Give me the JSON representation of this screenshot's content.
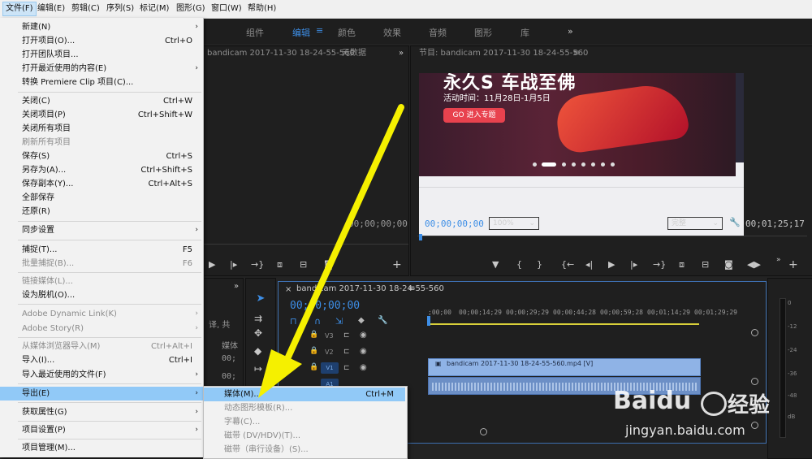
{
  "menubar": {
    "items": [
      "文件(F)",
      "编辑(E)",
      "剪辑(C)",
      "序列(S)",
      "标记(M)",
      "图形(G)",
      "窗口(W)",
      "帮助(H)"
    ]
  },
  "workspace_tabs": [
    "组件",
    "编辑",
    "颜色",
    "效果",
    "音频",
    "图形",
    "库"
  ],
  "workspace_more": "»",
  "source_panel": {
    "title": "bandicam 2017-11-30 18-24-55-560",
    "tab2": "元数据",
    "timecode": "00;00;00;00"
  },
  "program_panel": {
    "title": "节目: bandicam 2017-11-30 18-24-55-560",
    "timecode_left": "00;00;00;00",
    "zoom": "100%",
    "quality": "完整",
    "timecode_right": "00;01;25;17",
    "banner": {
      "headline": "永久S 车战至佛",
      "date_text": "活动时间：11月28日-1月5日",
      "button_text": "GO 进入专题"
    }
  },
  "project_panel": {
    "breadcrumb": "译, 共",
    "col_label": "媒体",
    "values": [
      "00;",
      "00;"
    ]
  },
  "timeline": {
    "tab_title": "bandicam 2017-11-30 18-24-55-560",
    "timecode": "00;00;00;00",
    "ruler": [
      ";00;00",
      "00;00;14;29",
      "00;00;29;29",
      "00;00;44;28",
      "00;00;59;28",
      "00;01;14;29",
      "00;01;29;29"
    ],
    "tracks": [
      "V3",
      "V2",
      "V1",
      "A1"
    ],
    "clip_label": "bandicam 2017-11-30 18-24-55-560.mp4 [V]"
  },
  "meter_labels": [
    "0",
    "-12",
    "-24",
    "-36",
    "-48",
    "dB"
  ],
  "file_menu": {
    "items": [
      {
        "label": "新建(N)",
        "shortcut": "",
        "submenu": true,
        "disabled": false
      },
      {
        "label": "打开项目(O)...",
        "shortcut": "Ctrl+O",
        "submenu": false,
        "disabled": false
      },
      {
        "label": "打开团队项目...",
        "shortcut": "",
        "submenu": false,
        "disabled": false
      },
      {
        "label": "打开最近使用的内容(E)",
        "shortcut": "",
        "submenu": true,
        "disabled": false
      },
      {
        "label": "转换 Premiere Clip 项目(C)...",
        "shortcut": "",
        "submenu": false,
        "disabled": false
      },
      {
        "label": "关闭(C)",
        "shortcut": "Ctrl+W",
        "submenu": false,
        "disabled": false
      },
      {
        "label": "关闭项目(P)",
        "shortcut": "Ctrl+Shift+W",
        "submenu": false,
        "disabled": false
      },
      {
        "label": "关闭所有项目",
        "shortcut": "",
        "submenu": false,
        "disabled": false
      },
      {
        "label": "刷新所有项目",
        "shortcut": "",
        "submenu": false,
        "disabled": true
      },
      {
        "label": "保存(S)",
        "shortcut": "Ctrl+S",
        "submenu": false,
        "disabled": false
      },
      {
        "label": "另存为(A)...",
        "shortcut": "Ctrl+Shift+S",
        "submenu": false,
        "disabled": false
      },
      {
        "label": "保存副本(Y)...",
        "shortcut": "Ctrl+Alt+S",
        "submenu": false,
        "disabled": false
      },
      {
        "label": "全部保存",
        "shortcut": "",
        "submenu": false,
        "disabled": false
      },
      {
        "label": "还原(R)",
        "shortcut": "",
        "submenu": false,
        "disabled": false
      },
      {
        "label": "同步设置",
        "shortcut": "",
        "submenu": true,
        "disabled": false
      },
      {
        "label": "捕捉(T)...",
        "shortcut": "F5",
        "submenu": false,
        "disabled": false
      },
      {
        "label": "批量捕捉(B)...",
        "shortcut": "F6",
        "submenu": false,
        "disabled": true
      },
      {
        "label": "链接媒体(L)...",
        "shortcut": "",
        "submenu": false,
        "disabled": true
      },
      {
        "label": "设为脱机(O)...",
        "shortcut": "",
        "submenu": false,
        "disabled": false
      },
      {
        "label": "Adobe Dynamic Link(K)",
        "shortcut": "",
        "submenu": true,
        "disabled": true
      },
      {
        "label": "Adobe Story(R)",
        "shortcut": "",
        "submenu": true,
        "disabled": true
      },
      {
        "label": "从媒体浏览器导入(M)",
        "shortcut": "Ctrl+Alt+I",
        "submenu": false,
        "disabled": true
      },
      {
        "label": "导入(I)...",
        "shortcut": "Ctrl+I",
        "submenu": false,
        "disabled": false
      },
      {
        "label": "导入最近使用的文件(F)",
        "shortcut": "",
        "submenu": true,
        "disabled": false
      },
      {
        "label": "导出(E)",
        "shortcut": "",
        "submenu": true,
        "disabled": false
      },
      {
        "label": "获取属性(G)",
        "shortcut": "",
        "submenu": true,
        "disabled": false
      },
      {
        "label": "项目设置(P)",
        "shortcut": "",
        "submenu": true,
        "disabled": false
      },
      {
        "label": "项目管理(M)...",
        "shortcut": "",
        "submenu": false,
        "disabled": false
      }
    ]
  },
  "export_submenu": {
    "items": [
      {
        "label": "媒体(M)...",
        "shortcut": "Ctrl+M",
        "disabled": false
      },
      {
        "label": "动态图形模板(R)...",
        "shortcut": "",
        "disabled": true
      },
      {
        "label": "字幕(C)...",
        "shortcut": "",
        "disabled": true
      },
      {
        "label": "磁带 (DV/HDV)(T)...",
        "shortcut": "",
        "disabled": true
      },
      {
        "label": "磁带（串行设备）(S)...",
        "shortcut": "",
        "disabled": true
      }
    ]
  },
  "watermark": {
    "brand": "Baidu",
    "cn": "经验",
    "url": "jingyan.baidu.com"
  },
  "colors": {
    "accent_blue": "#3d8ee6",
    "menu_highlight": "#91c9f7",
    "annotation_arrow": "#f5f000",
    "clip_blue": "#8fb3e6"
  }
}
